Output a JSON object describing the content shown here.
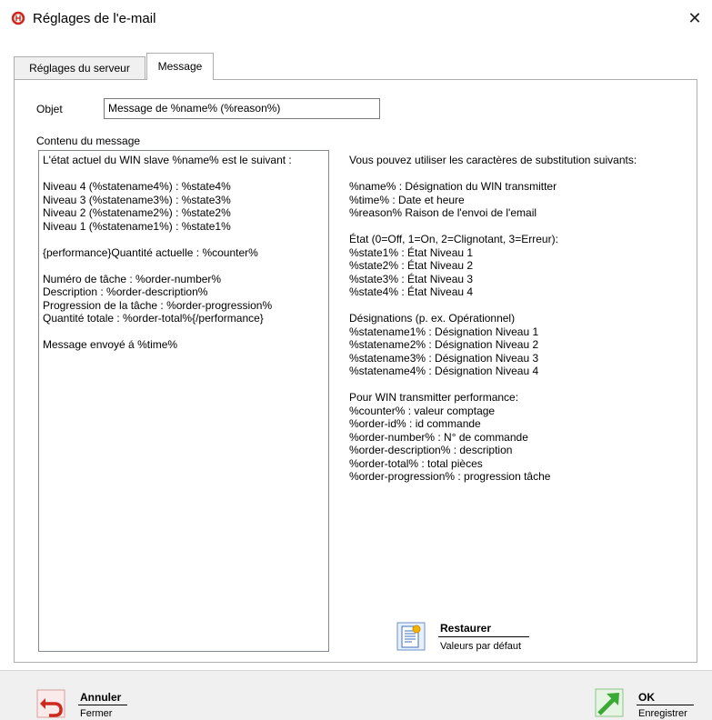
{
  "window": {
    "title": "Réglages de l'e-mail",
    "close_glyph": "✕"
  },
  "tabs": [
    {
      "label": "Réglages du serveur",
      "active": false
    },
    {
      "label": "Message",
      "active": true
    }
  ],
  "subject": {
    "label": "Objet",
    "value": "Message de %name% (%reason%)"
  },
  "message": {
    "label": "Contenu du message",
    "lines": [
      "L'état actuel du WIN slave %name% est le suivant :",
      "",
      "Niveau 4 (%statename4%) : %state4%",
      "Niveau 3 (%statename3%) : %state3%",
      "Niveau 2 (%statename2%) : %state2%",
      "Niveau 1 (%statename1%) : %state1%",
      "",
      "{performance}Quantité actuelle : %counter%",
      "",
      "Numéro de tâche : %order-number%",
      "Description : %order-description%",
      "Progression de la tâche : %order-progression%",
      "Quantité totale : %order-total%{/performance}",
      "",
      "Message envoyé á %time%"
    ]
  },
  "help": {
    "lines": [
      "Vous pouvez utiliser les caractères de substitution suivants:",
      "",
      "%name% : Désignation du WIN transmitter",
      "%time% : Date et heure",
      "%reason% Raison de l'envoi de l'email",
      "",
      "État (0=Off, 1=On, 2=Clignotant, 3=Erreur):",
      "%state1% : État Niveau 1",
      "%state2% : État Niveau 2",
      "%state3% : État Niveau 3",
      "%state4% : État Niveau 4",
      "",
      "Désignations (p. ex. Opérationnel)",
      "%statename1% : Désignation Niveau 1",
      "%statename2% : Désignation Niveau 2",
      "%statename3% : Désignation Niveau 3",
      "%statename4% : Désignation Niveau 4",
      "",
      "Pour WIN transmitter performance:",
      "%counter% : valeur comptage",
      "%order-id% : id commande",
      "%order-number% : N° de commande",
      "%order-description% : description",
      "%order-total% : total pièces",
      "%order-progression% : progression tâche"
    ]
  },
  "restore_button": {
    "title": "Restaurer",
    "subtitle": "Valeurs par défaut",
    "icon": "document-restore-icon"
  },
  "cancel_button": {
    "title": "Annuler",
    "subtitle": "Fermer",
    "icon": "undo-arrow-icon"
  },
  "ok_button": {
    "title": "OK",
    "subtitle": "Enregistrer",
    "icon": "green-arrow-icon"
  },
  "colors": {
    "accent_red": "#cc2a1f",
    "accent_green": "#3aa935",
    "panel_border": "#adadad",
    "footer_bg": "#f0f0f0"
  }
}
